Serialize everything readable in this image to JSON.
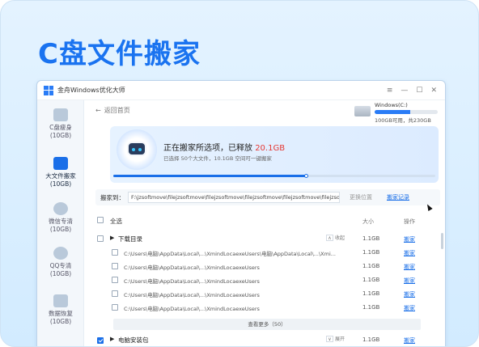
{
  "headline": "C盘文件搬家",
  "app": {
    "title": "金舟Windows优化大师",
    "controls": [
      "≡",
      "—",
      "☐",
      "✕"
    ]
  },
  "sidebar": {
    "items": [
      {
        "label": "C盘瘦身",
        "sub": "(10GB)",
        "active": false
      },
      {
        "label": "大文件搬家",
        "sub": "(10GB)",
        "active": true
      },
      {
        "label": "微信专清",
        "sub": "(10GB)",
        "active": false
      },
      {
        "label": "QQ专清",
        "sub": "(10GB)",
        "active": false
      },
      {
        "label": "数据恢复",
        "sub": "(10GB)",
        "active": false
      }
    ]
  },
  "nav": {
    "back_arrow": "←",
    "back_label": "返回首页"
  },
  "disk": {
    "name": "Windows(C:)",
    "info": "100GB可用，共230GB",
    "used_fraction": 0.57
  },
  "banner": {
    "title_prefix": "正在搬家所选项，已释放 ",
    "freed": "20.1GB",
    "subtitle": "已选择 50个大文件，10.1GB 空间可一键搬家",
    "progress": 0.6
  },
  "destination": {
    "label": "搬家到：",
    "value": "F:\\jzsoftmove\\filejzsoftmove\\filejzsoftmove\\filejzsoftmove\\filejzsoftmove\\filejzsoftmove\\filejz...",
    "change_label": "更换位置",
    "record_label": "搬家记录"
  },
  "table": {
    "select_all": "全选",
    "size_header": "大小",
    "op_header": "操作",
    "groups": [
      {
        "name": "下载目录",
        "fold_label": "收起",
        "fold_glyph": "∧",
        "size": "1.1GB",
        "op": "搬家",
        "checked": false,
        "files": [
          {
            "path": "C:\\Users\\电脑\\AppData\\Local\\...\\XmindLocaexeUsers\\电脑\\AppData\\Local\\...\\Xmi...",
            "size": "1.1GB",
            "op": "搬家"
          },
          {
            "path": "C:\\Users\\电脑\\AppData\\Local\\...\\XmindLocaexeUsers",
            "size": "1.1GB",
            "op": "搬家"
          },
          {
            "path": "C:\\Users\\电脑\\AppData\\Local\\...\\XmindLocaexeUsers",
            "size": "1.1GB",
            "op": "搬家"
          },
          {
            "path": "C:\\Users\\电脑\\AppData\\Local\\...\\XmindLocaexeUsers",
            "size": "1.1GB",
            "op": "搬家"
          },
          {
            "path": "C:\\Users\\电脑\\AppData\\Local\\...\\XmindLocaexeUsers",
            "size": "1.1GB",
            "op": "搬家"
          }
        ],
        "view_more": "查看更多（50）"
      },
      {
        "name": "电脑安装包",
        "fold_label": "展开",
        "fold_glyph": "∨",
        "size": "1.1GB",
        "op": "搬家",
        "checked": true
      }
    ]
  },
  "colors": {
    "accent": "#1a6fe8",
    "headline": "#1a73f0",
    "freed": "#e53935"
  }
}
